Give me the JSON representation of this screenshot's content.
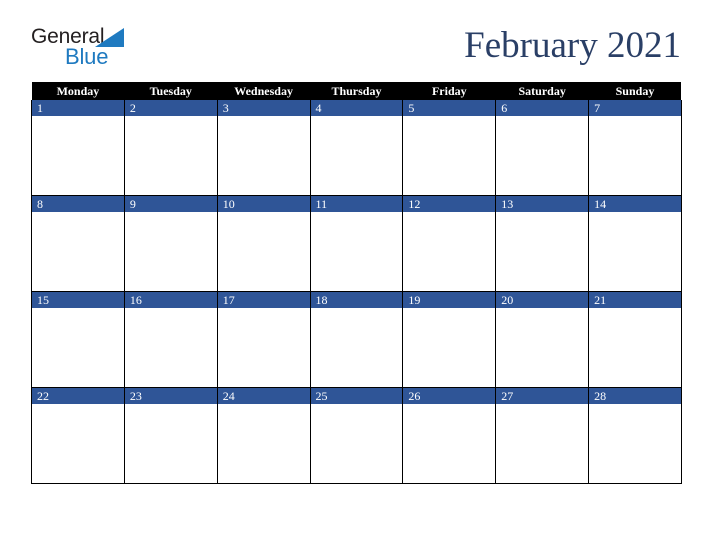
{
  "brand": {
    "line1": "General",
    "line2": "Blue",
    "triangle_icon": "triangle-icon",
    "line1_color": "#231f20",
    "line2_color": "#1f7ac0",
    "triangle_color": "#1f7ac0"
  },
  "header": {
    "title": "February 2021",
    "title_color": "#2a3f66"
  },
  "calendar": {
    "month": "February",
    "year": "2021",
    "week_start": "Monday",
    "header_bg": "#000000",
    "header_fg": "#ffffff",
    "date_bar_bg": "#2f5597",
    "date_bar_fg": "#ffffff",
    "cell_bg": "#ffffff",
    "grid_line_color": "#000000",
    "weekdays": [
      "Monday",
      "Tuesday",
      "Wednesday",
      "Thursday",
      "Friday",
      "Saturday",
      "Sunday"
    ],
    "weeks": [
      [
        {
          "day": "1",
          "blank": false,
          "events": ""
        },
        {
          "day": "2",
          "blank": false,
          "events": ""
        },
        {
          "day": "3",
          "blank": false,
          "events": ""
        },
        {
          "day": "4",
          "blank": false,
          "events": ""
        },
        {
          "day": "5",
          "blank": false,
          "events": ""
        },
        {
          "day": "6",
          "blank": false,
          "events": ""
        },
        {
          "day": "7",
          "blank": false,
          "events": ""
        }
      ],
      [
        {
          "day": "8",
          "blank": false,
          "events": ""
        },
        {
          "day": "9",
          "blank": false,
          "events": ""
        },
        {
          "day": "10",
          "blank": false,
          "events": ""
        },
        {
          "day": "11",
          "blank": false,
          "events": ""
        },
        {
          "day": "12",
          "blank": false,
          "events": ""
        },
        {
          "day": "13",
          "blank": false,
          "events": ""
        },
        {
          "day": "14",
          "blank": false,
          "events": ""
        }
      ],
      [
        {
          "day": "15",
          "blank": false,
          "events": ""
        },
        {
          "day": "16",
          "blank": false,
          "events": ""
        },
        {
          "day": "17",
          "blank": false,
          "events": ""
        },
        {
          "day": "18",
          "blank": false,
          "events": ""
        },
        {
          "day": "19",
          "blank": false,
          "events": ""
        },
        {
          "day": "20",
          "blank": false,
          "events": ""
        },
        {
          "day": "21",
          "blank": false,
          "events": ""
        }
      ],
      [
        {
          "day": "22",
          "blank": false,
          "events": ""
        },
        {
          "day": "23",
          "blank": false,
          "events": ""
        },
        {
          "day": "24",
          "blank": false,
          "events": ""
        },
        {
          "day": "25",
          "blank": false,
          "events": ""
        },
        {
          "day": "26",
          "blank": false,
          "events": ""
        },
        {
          "day": "27",
          "blank": false,
          "events": ""
        },
        {
          "day": "28",
          "blank": false,
          "events": ""
        }
      ]
    ]
  }
}
